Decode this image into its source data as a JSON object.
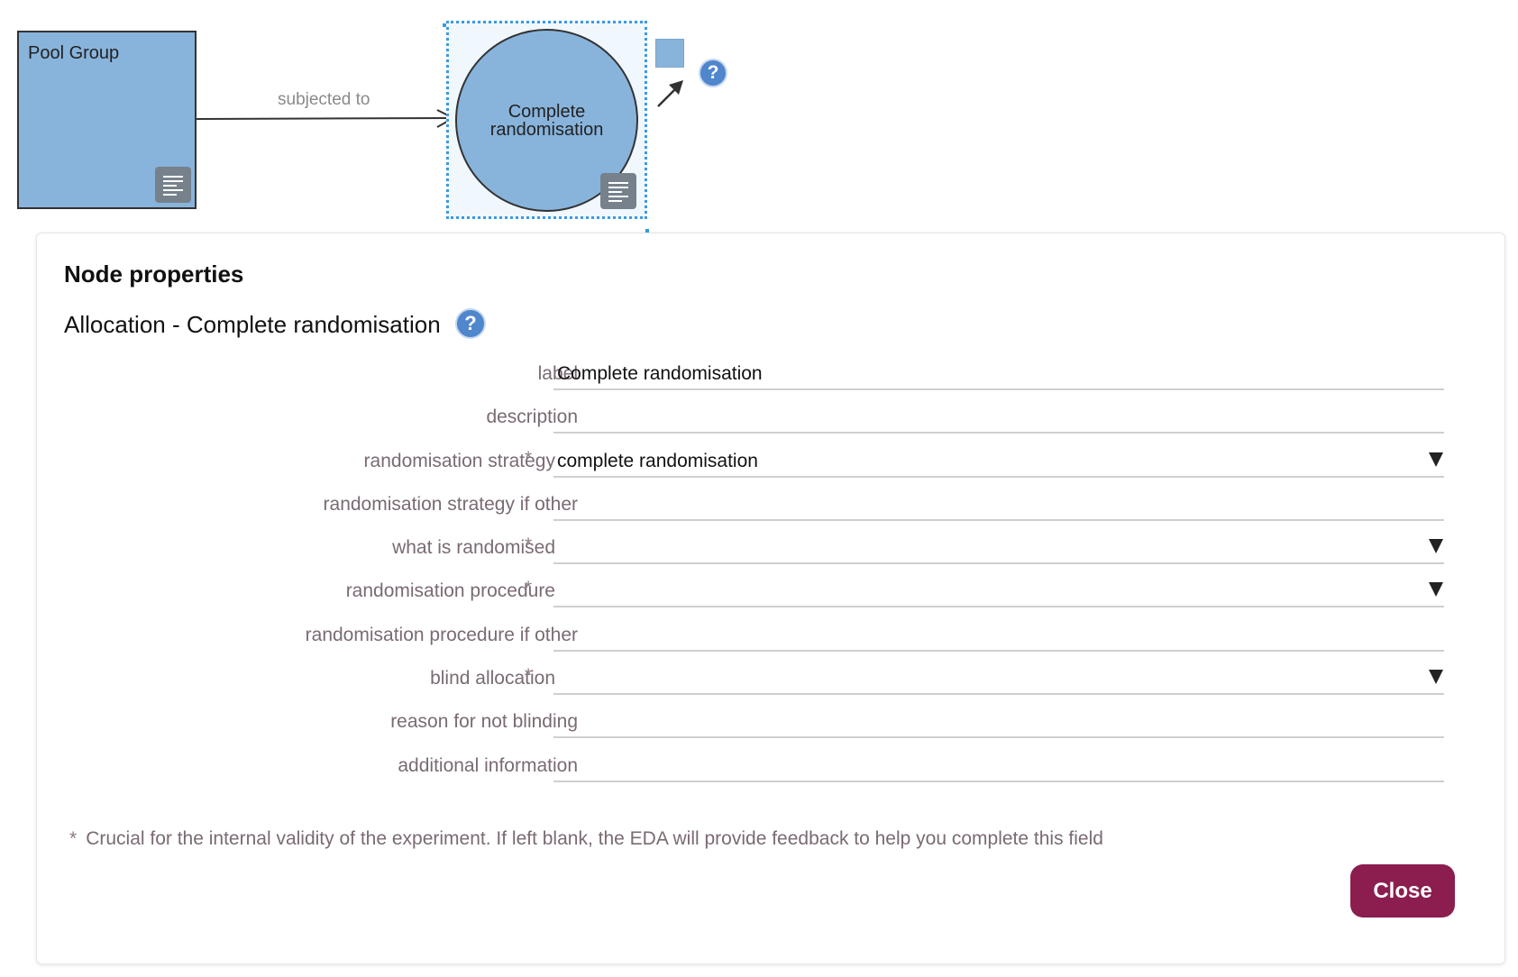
{
  "diagram": {
    "pool_node": {
      "label": "Pool Group",
      "icon": "document-lines-icon"
    },
    "edge": {
      "label": "subjected to"
    },
    "allocation_node": {
      "label": "Complete\nrandomisation",
      "icon": "document-lines-icon"
    },
    "connector_tools": {
      "square_icon": "blue-square-icon",
      "arrow_icon": "diagonal-arrow-icon",
      "help_icon": "question-mark-icon",
      "help_text": "?"
    },
    "colors": {
      "node_fill": "#88b4dc",
      "selection": "#3b9be0"
    }
  },
  "panel": {
    "title": "Node properties",
    "subtitle": "Allocation - Complete randomisation",
    "help_text": "?",
    "fields": [
      {
        "label": "label",
        "value": "Complete randomisation",
        "required": false,
        "dropdown": false
      },
      {
        "label": "description",
        "value": "",
        "required": false,
        "dropdown": false
      },
      {
        "label": "randomisation strategy",
        "value": "complete randomisation",
        "required": true,
        "dropdown": true
      },
      {
        "label": "randomisation strategy if other",
        "value": "",
        "required": false,
        "dropdown": false
      },
      {
        "label": "what is randomised",
        "value": "",
        "required": true,
        "dropdown": true
      },
      {
        "label": "randomisation procedure",
        "value": "",
        "required": true,
        "dropdown": true
      },
      {
        "label": "randomisation procedure if other",
        "value": "",
        "required": false,
        "dropdown": false
      },
      {
        "label": "blind allocation",
        "value": "",
        "required": true,
        "dropdown": true
      },
      {
        "label": "reason for not blinding",
        "value": "",
        "required": false,
        "dropdown": false
      },
      {
        "label": "additional information",
        "value": "",
        "required": false,
        "dropdown": false
      }
    ],
    "required_marker": "*",
    "footnote": "Crucial for the internal validity of the experiment. If left blank, the EDA will provide feedback to help you complete this field",
    "close_label": "Close",
    "colors": {
      "close_button": "#8c1d4f",
      "label_text": "#7a6a74"
    }
  }
}
